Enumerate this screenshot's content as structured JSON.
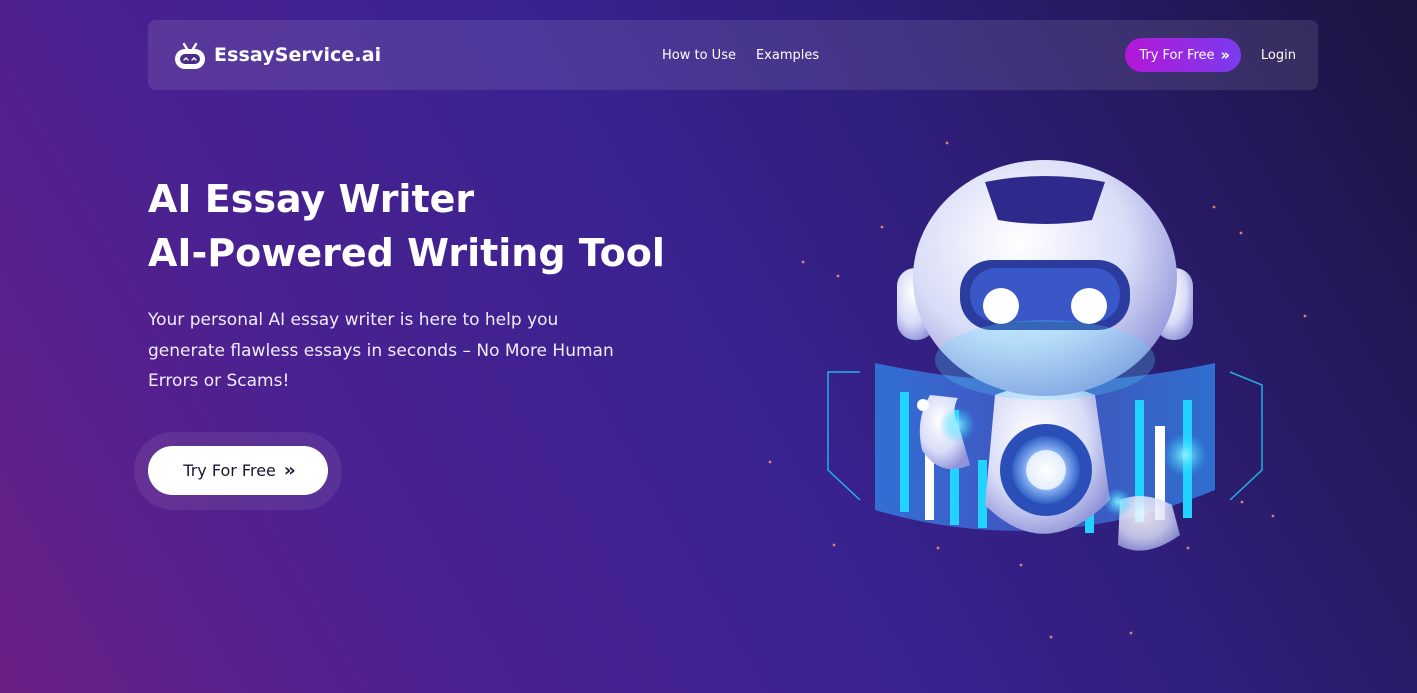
{
  "brand": {
    "name": "EssayService.ai"
  },
  "nav": {
    "links": [
      "How to Use",
      "Examples"
    ],
    "cta_label": "Try For Free",
    "login_label": "Login"
  },
  "hero": {
    "title_line1": "AI Essay Writer",
    "title_line2": "AI-Powered Writing Tool",
    "description": "Your personal AI essay writer is here to help you generate flawless essays in seconds – No More Human Errors or Scams!",
    "cta_label": "Try For Free"
  },
  "icons": {
    "logo": "robot-head-icon",
    "cta_arrow": "double-chevron-right-icon"
  },
  "colors": {
    "accent_gradient_start": "#b417d6",
    "accent_gradient_end": "#7a3cf0",
    "cyan_glow": "#22d3ff"
  }
}
